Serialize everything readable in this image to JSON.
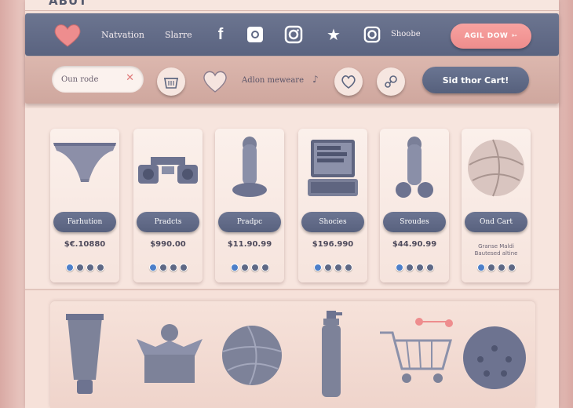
{
  "header": {
    "logo_text": "ABUT"
  },
  "nav": {
    "links": [
      "Natvation",
      "Slarre"
    ],
    "social_label": "Shoobe",
    "cta": "AGIL DOW"
  },
  "toolbar": {
    "search_value": "Oun rode",
    "label": "Adlon meweare",
    "cart_button": "Sid thor Cart!"
  },
  "products": [
    {
      "tag": "Farhution",
      "price": "$€.10880",
      "sub": ""
    },
    {
      "tag": "Pradcts",
      "price": "$990.00",
      "sub": ""
    },
    {
      "tag": "Pradpc",
      "price": "$11.90.99",
      "sub": ""
    },
    {
      "tag": "Shocies",
      "price": "$196.990",
      "sub": ""
    },
    {
      "tag": "Sroudes",
      "price": "$44.90.99",
      "sub": ""
    },
    {
      "tag": "Ond Cart",
      "price": "",
      "sub": "Granse Maldi Bautesed altine"
    }
  ],
  "colors": {
    "nav": "#5f6884",
    "accent": "#f09a98",
    "background": "#f6e1d9"
  }
}
